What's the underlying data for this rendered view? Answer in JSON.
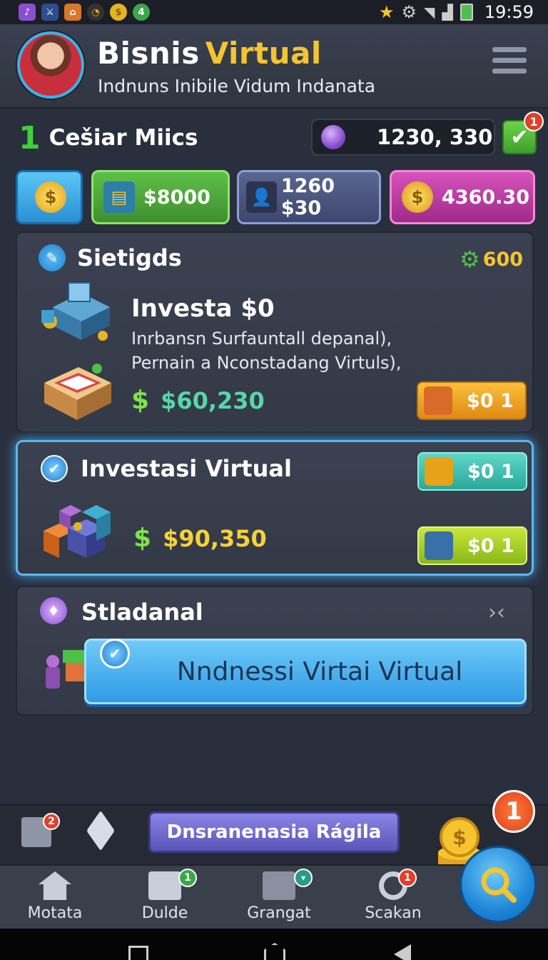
{
  "status_bar": {
    "time": "19:59",
    "icons": [
      "purple-app-icon",
      "shield-app-icon",
      "orange-app-icon",
      "clock-icon",
      "coin-icon",
      "green-badge-icon"
    ],
    "green_badge": "4"
  },
  "header": {
    "title_part1": "Bisnis",
    "title_part2": "Virtual",
    "subtitle": "Indnuns Inibile  Vidum Indanata"
  },
  "level": {
    "number": "1",
    "name": "Cešiar Miics",
    "gems": "1230, 330",
    "check_badge": "1"
  },
  "currencies": [
    {
      "label": "",
      "icon": "dollar-coin-icon",
      "color": "#3aaee8"
    },
    {
      "label": "$8000",
      "icon": "cash-stack-icon",
      "color": "#4fa83a"
    },
    {
      "label": "1260 $30",
      "icon": "businessman-icon",
      "color": "#4a5680"
    },
    {
      "label": "4360.30",
      "icon": "gold-coins-icon",
      "color": "#c23ea8"
    }
  ],
  "cards": [
    {
      "title": "Sietigds",
      "gear_value": "600",
      "heading": "Investa $0",
      "desc1": "Inrbansn Surfauntall depanal),",
      "desc2": "Pernain a Nconstadang Virtuls),",
      "money": "$60,230",
      "pill": "$0  1"
    },
    {
      "title": "Investasi Virtual",
      "money": "$90,350",
      "pill1": "$0  1",
      "pill2": "$0  1"
    },
    {
      "title": "Stladanal",
      "action": "Nndnessi Virtai Virtual"
    }
  ],
  "bottom": {
    "promo": "Dnsranenasia Rágila",
    "shop_badge": "2",
    "fab_badge": "1"
  },
  "nav": [
    {
      "label": "Motata",
      "icon": "home-icon",
      "badge": ""
    },
    {
      "label": "Dulde",
      "icon": "flag-icon",
      "badge": "1"
    },
    {
      "label": "Grangat",
      "icon": "checklist-icon",
      "badge": "▾"
    },
    {
      "label": "Scakan",
      "icon": "search-icon",
      "badge": "1"
    }
  ]
}
